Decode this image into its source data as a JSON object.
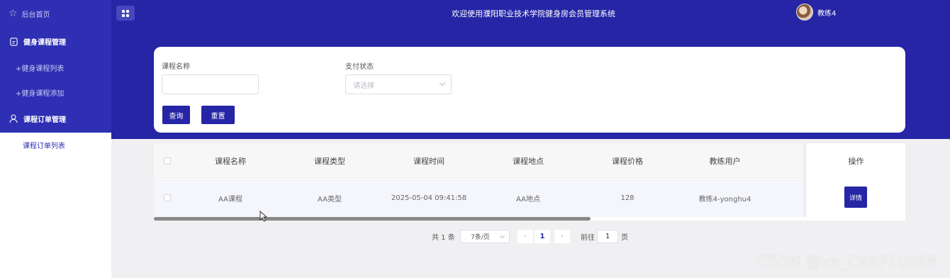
{
  "sidebar": {
    "home": "后台首页",
    "group1": "健身课程管理",
    "group1_items": [
      "+健身课程列表",
      "+健身课程添加"
    ],
    "group2": "课程订单管理",
    "active_item": "课程订单列表"
  },
  "header": {
    "title": "欢迎使用濮阳职业技术学院健身房会员管理系统",
    "username": "教练4"
  },
  "search": {
    "course_name_label": "课程名称",
    "course_name_value": "",
    "pay_status_label": "支付状态",
    "pay_status_placeholder": "请选择",
    "query_button": "查询",
    "reset_button": "重置"
  },
  "table": {
    "columns": [
      "课程名称",
      "课程类型",
      "课程时间",
      "课程地点",
      "课程价格",
      "教练用户",
      "操作"
    ],
    "rows": [
      {
        "name": "AA课程",
        "type": "AA类型",
        "time": "2025-05-04 09:41:58",
        "location": "AA地点",
        "price": "128",
        "coach": "教练4-yonghu4",
        "action": "详情"
      }
    ]
  },
  "pagination": {
    "total": "共 1 条",
    "page_size": "7条/页",
    "prev": "‹",
    "current_page": "1",
    "next": "›",
    "goto_label": "前往",
    "goto_value": "1",
    "page_unit": "页"
  },
  "watermark": "CSDN @vx_CXKF10088",
  "colors": {
    "primary": "#2525a6",
    "sidebar": "#2e2fb3"
  }
}
